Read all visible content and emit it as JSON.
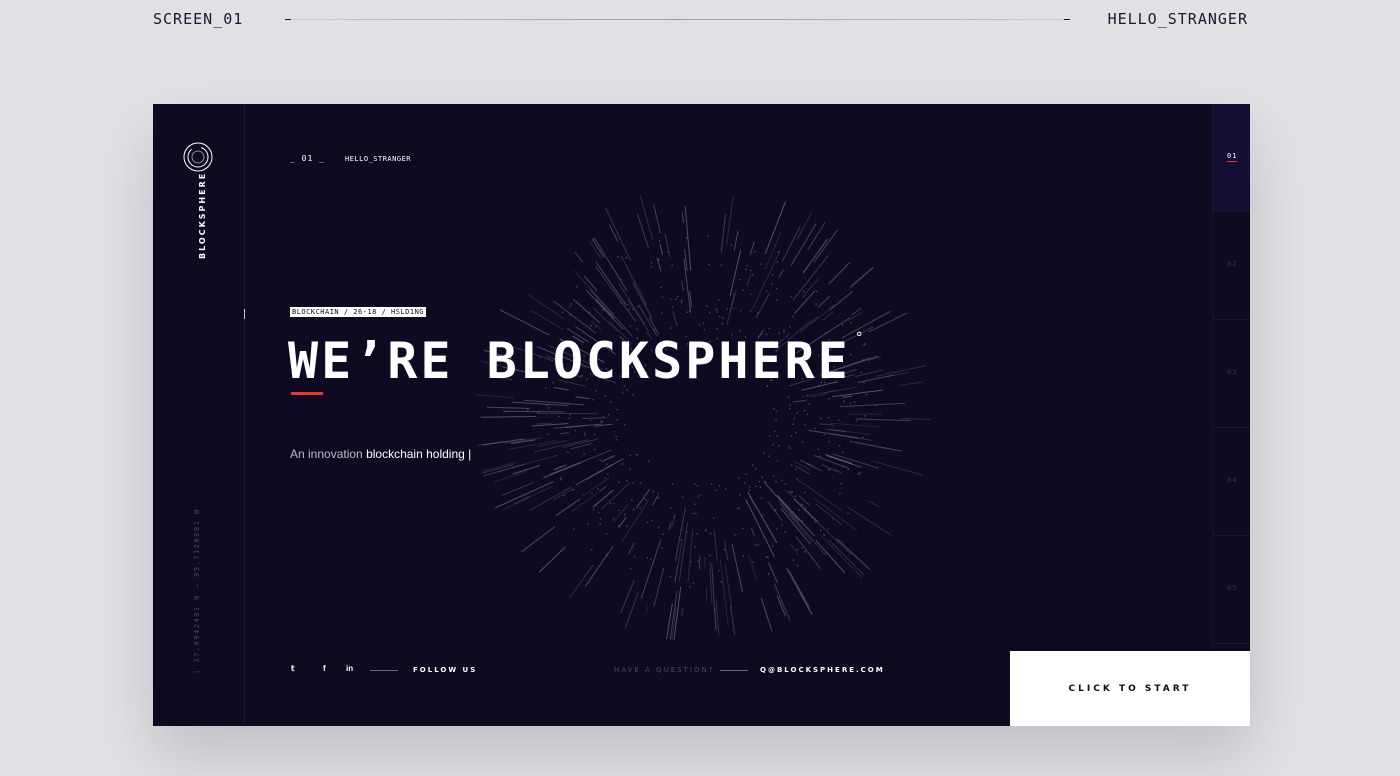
{
  "outer": {
    "screen_label": "SCREEN_01",
    "hello_label": "HELLO_STRANGER"
  },
  "sidebar": {
    "brand": "BLOCKSPHERE",
    "coords": "| 37.8942491 N — 95.7128691 W"
  },
  "header": {
    "index": "_ 01 _",
    "hello": "HELLO_STRANGER"
  },
  "hero": {
    "tag": "BLOCKCHAIN /  26-18 / HSLD1NG",
    "title": "WE’RE BLOCKSPHERE",
    "title_mark": "°",
    "subtitle_start": "An innovation ",
    "subtitle_bold": "blockchain holding |"
  },
  "pager": {
    "pages": [
      "01",
      "02",
      "03",
      "04",
      "05"
    ],
    "active": "01"
  },
  "footer": {
    "social": {
      "twitter": "𝕥",
      "facebook": "f",
      "linkedin": "in"
    },
    "follow": "FOLLOW US",
    "question": "HAVE A QUESTION?",
    "email": "Q@BLOCKSPHERE.COM",
    "cta": "CLICK TO START"
  },
  "colors": {
    "background": "#e1e0e5",
    "frame": "#0f0a22",
    "accent": "#e03a2f",
    "text": "#ffffff"
  }
}
